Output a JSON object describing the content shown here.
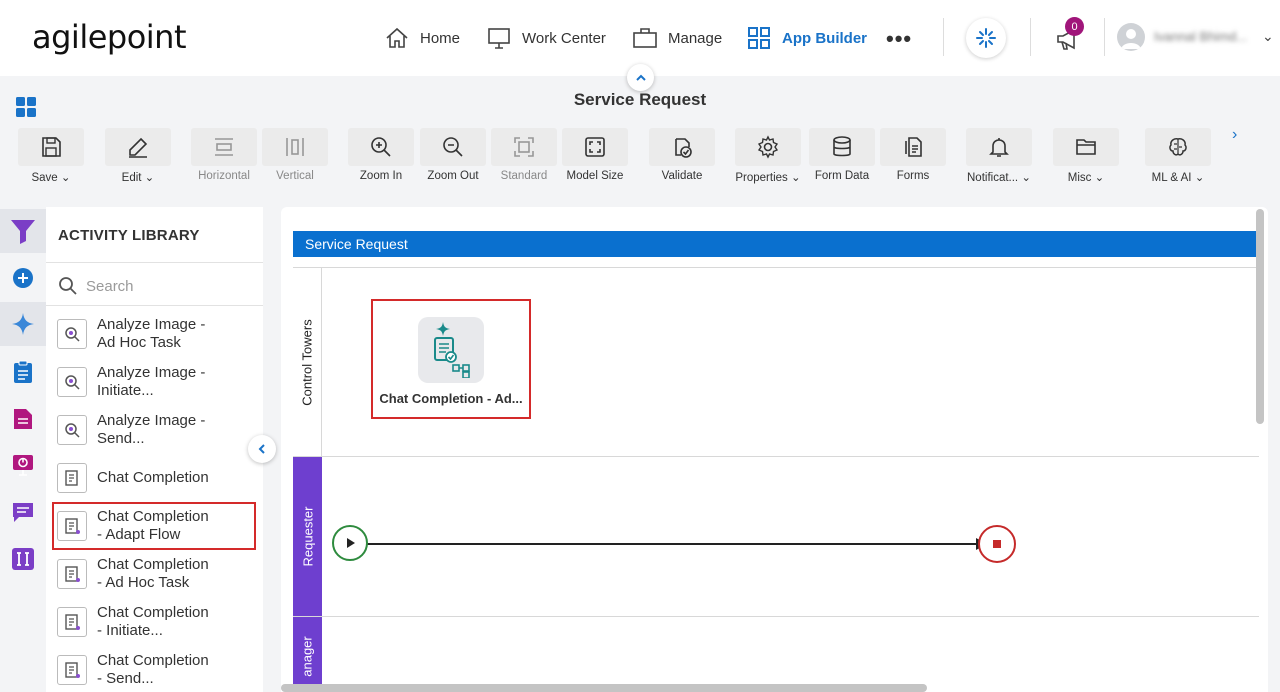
{
  "brand": {
    "logo_text": "agilepoint"
  },
  "nav": {
    "home": "Home",
    "work_center": "Work Center",
    "manage": "Manage",
    "app_builder": "App Builder",
    "more": "•••",
    "notifications_count": "0",
    "user_name": "Ivannal Bhimd..."
  },
  "header": {
    "title": "Service Request"
  },
  "toolbar": {
    "save": "Save",
    "edit": "Edit",
    "horizontal": "Horizontal",
    "vertical": "Vertical",
    "zoom_in": "Zoom In",
    "zoom_out": "Zoom Out",
    "standard": "Standard",
    "model_size": "Model Size",
    "validate": "Validate",
    "properties": "Properties",
    "form_data": "Form Data",
    "forms": "Forms",
    "notifications": "Notificat...",
    "misc": "Misc",
    "ml_ai": "ML & AI"
  },
  "library": {
    "title": "ACTIVITY LIBRARY",
    "search_placeholder": "Search",
    "items": [
      {
        "line1": "Analyze Image -",
        "line2": "Ad Hoc Task"
      },
      {
        "line1": "Analyze Image -",
        "line2": "Initiate..."
      },
      {
        "line1": "Analyze Image -",
        "line2": "Send..."
      },
      {
        "line1": "Chat Completion",
        "line2": ""
      },
      {
        "line1": "Chat Completion",
        "line2": "- Adapt Flow"
      },
      {
        "line1": "Chat Completion",
        "line2": "- Ad Hoc Task"
      },
      {
        "line1": "Chat Completion",
        "line2": "- Initiate..."
      },
      {
        "line1": "Chat Completion",
        "line2": "- Send..."
      }
    ]
  },
  "canvas": {
    "pool_title": "Service Request",
    "lanes": [
      "Control Towers",
      "Requester",
      "anager"
    ],
    "activity_label": "Chat Completion - Ad..."
  },
  "colors": {
    "accent": "#1a73c8",
    "pool_header": "#0a70cf",
    "lane_purple": "#6e3fcf",
    "highlight": "#d42a2a",
    "start": "#2e8b3e",
    "end": "#c52a2a"
  }
}
